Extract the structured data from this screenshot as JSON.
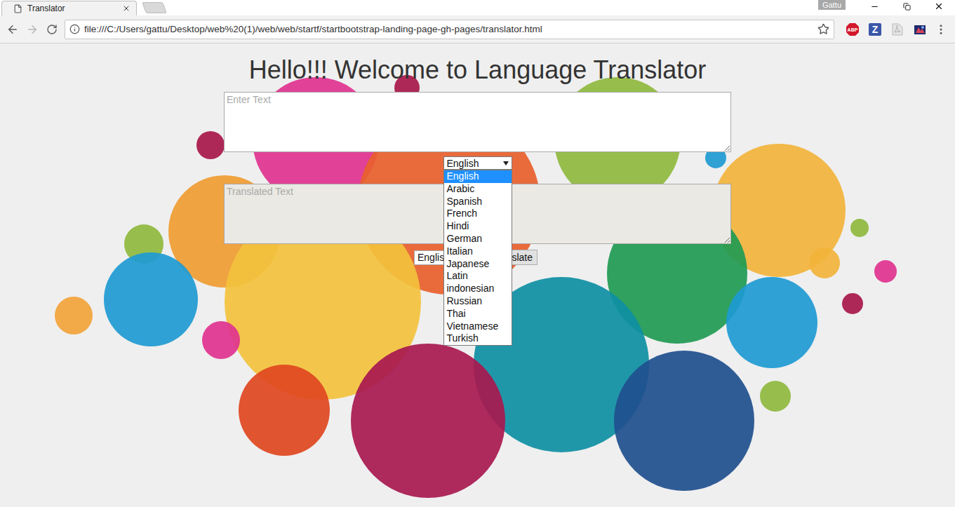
{
  "window": {
    "profile": "Gattu"
  },
  "tabs": [
    {
      "label": "Translator",
      "selected": true
    }
  ],
  "address_bar": {
    "url": "file:///C:/Users/gattu/Desktop/web%20(1)/web/web/startf/startbootstrap-landing-page-gh-pages/translator.html",
    "bookmarked": false
  },
  "extensions": [
    {
      "label": "ABP",
      "color": "#d2182b"
    },
    {
      "label": "Z",
      "color": "#3a56a8"
    }
  ],
  "page": {
    "heading": "Hello!!! Welcome to Language Translator",
    "input": {
      "placeholder": "Enter Text"
    },
    "target_select": {
      "value": "English",
      "expanded": true,
      "options": [
        {
          "label": "English",
          "selected": true
        },
        {
          "label": "Arabic",
          "selected": false
        },
        {
          "label": "Spanish",
          "selected": false
        },
        {
          "label": "French",
          "selected": false
        },
        {
          "label": "Hindi",
          "selected": false
        },
        {
          "label": "German",
          "selected": false
        },
        {
          "label": "Italian",
          "selected": false
        },
        {
          "label": "Japanese",
          "selected": false
        },
        {
          "label": "Latin",
          "selected": false
        },
        {
          "label": "indonesian",
          "selected": false
        },
        {
          "label": "Russian",
          "selected": false
        },
        {
          "label": "Thai",
          "selected": false
        },
        {
          "label": "Vietnamese",
          "selected": false
        },
        {
          "label": "Turkish",
          "selected": false
        }
      ]
    },
    "output": {
      "placeholder": "Translated Text"
    },
    "source_select": {
      "value": "Englis"
    },
    "translate_button": {
      "label": "nslate"
    }
  }
}
